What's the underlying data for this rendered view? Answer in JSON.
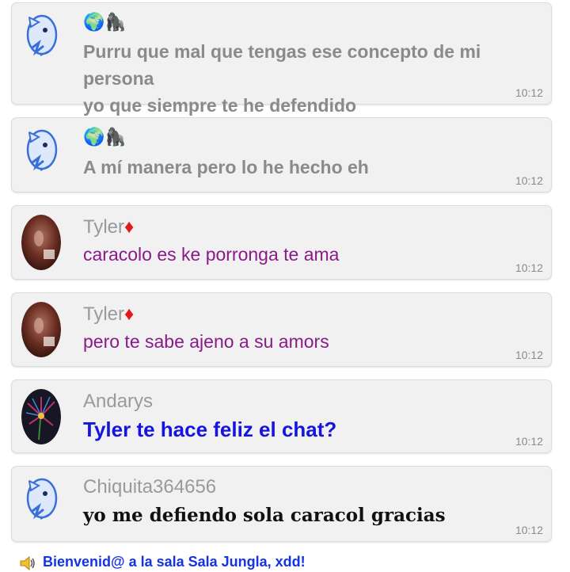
{
  "messages": [
    {
      "name_emojis": "🌍🦍",
      "text_line1": "Purru que mal que tengas ese concepto de mi persona",
      "text_line2": "yo que siempre te he defendido",
      "time": "10:12",
      "avatar": "pokemon-avatar"
    },
    {
      "name_emojis": "🌍🦍",
      "text": "A mí manera pero lo he hecho eh",
      "time": "10:12",
      "avatar": "pokemon-avatar"
    },
    {
      "username": "Tyler",
      "badge": "♦",
      "text": "caracolo es ke porronga te ama",
      "time": "10:12",
      "avatar": "photo-avatar"
    },
    {
      "username": "Tyler",
      "badge": "♦",
      "text": "pero te sabe ajeno a su amors",
      "time": "10:12",
      "avatar": "photo-avatar"
    },
    {
      "username": "Andarys",
      "text": "Tyler te hace feliz el chat?",
      "time": "10:12",
      "avatar": "flower-avatar"
    },
    {
      "username": "Chiquita364656",
      "text": "yo me defiendo sola caracol gracias",
      "time": "10:12",
      "avatar": "pokemon-avatar"
    }
  ],
  "footer": {
    "welcome": "Bienvenid@ a la sala Sala Jungla, xdd!",
    "icon": "speaker-icon"
  },
  "colors": {
    "bubble_bg": "#f1f1f1",
    "purple_text": "#8a1a8a",
    "blue_text": "#1414e0",
    "welcome_text": "#1433e6",
    "diamond": "#e41a1a"
  }
}
